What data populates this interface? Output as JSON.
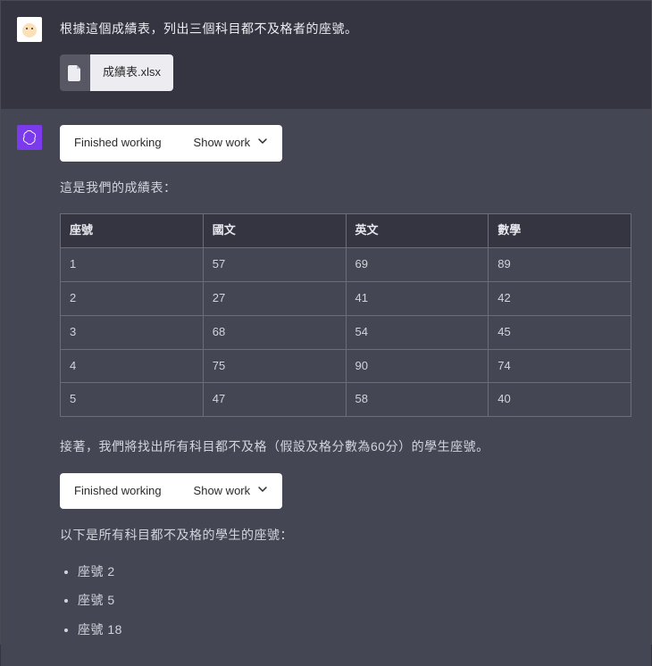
{
  "user": {
    "prompt": "根據這個成績表，列出三個科目都不及格者的座號。",
    "file": {
      "name": "成績表.xlsx"
    }
  },
  "assistant": {
    "working1": {
      "status": "Finished working",
      "toggle": "Show work"
    },
    "intro": "這是我們的成績表：",
    "table": {
      "headers": [
        "座號",
        "國文",
        "英文",
        "數學"
      ],
      "rows": [
        [
          "1",
          "57",
          "69",
          "89"
        ],
        [
          "2",
          "27",
          "41",
          "42"
        ],
        [
          "3",
          "68",
          "54",
          "45"
        ],
        [
          "4",
          "75",
          "90",
          "74"
        ],
        [
          "5",
          "47",
          "58",
          "40"
        ]
      ]
    },
    "followup": "接著，我們將找出所有科目都不及格（假設及格分數為60分）的學生座號。",
    "working2": {
      "status": "Finished working",
      "toggle": "Show work"
    },
    "result_intro": "以下是所有科目都不及格的學生的座號：",
    "results": [
      "座號 2",
      "座號 5",
      "座號 18"
    ]
  }
}
